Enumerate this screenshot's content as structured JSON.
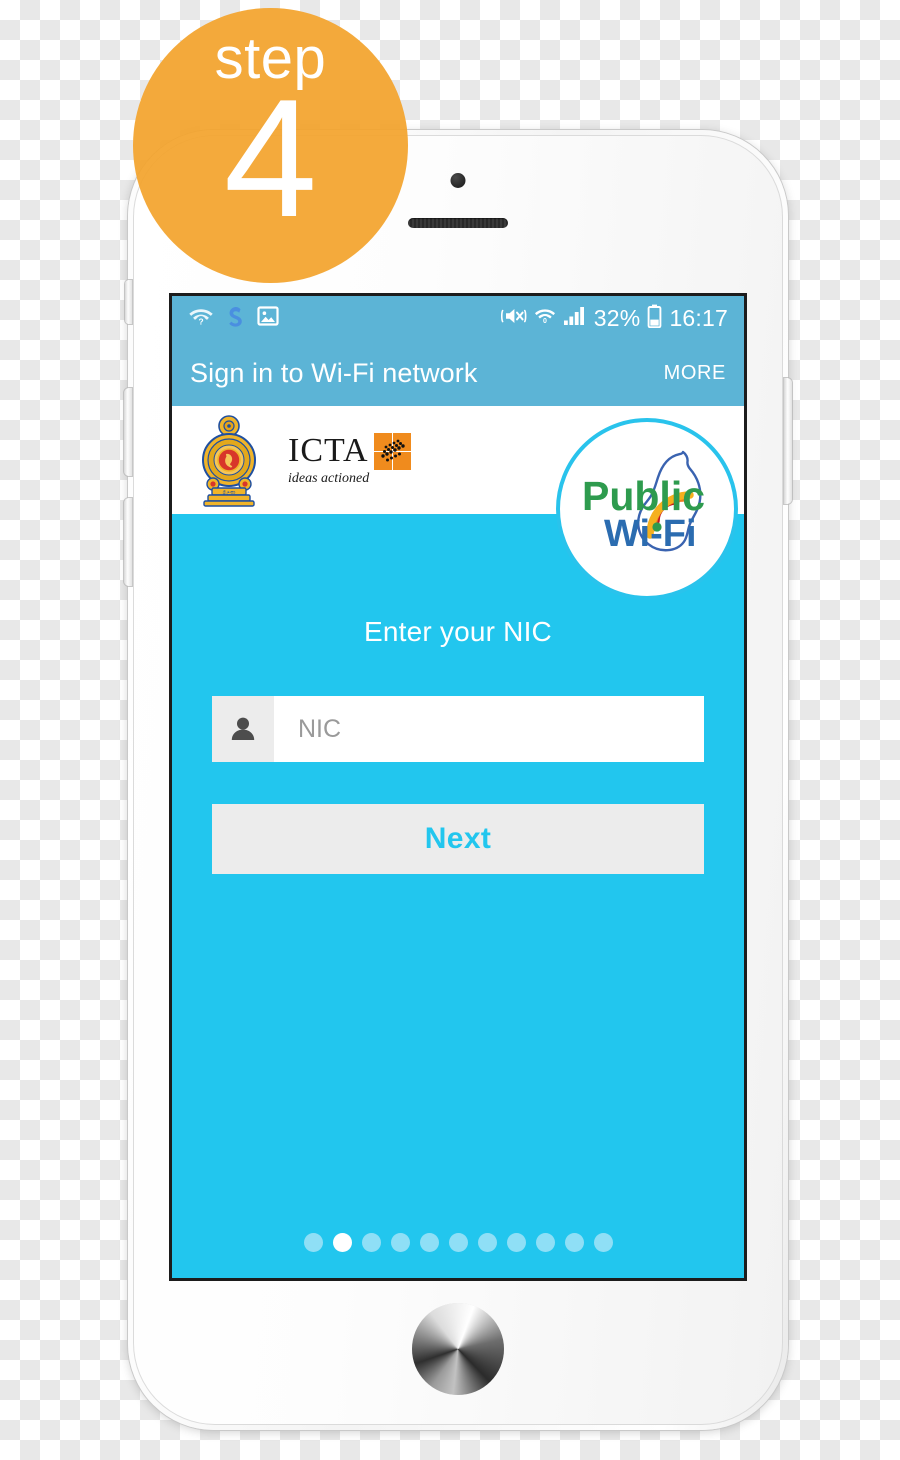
{
  "step_badge": {
    "label": "step",
    "number": "4",
    "color": "#f3a42d"
  },
  "device": {
    "name": "white-smartphone",
    "hardware": {
      "front_camera": "camera-icon",
      "earpiece_speaker": "speaker-grille",
      "home_button": "home-button",
      "silent_switch": "silent-switch",
      "volume_up": "volume-up-button",
      "volume_down": "volume-down-button",
      "power": "power-button"
    }
  },
  "screen": {
    "status_bar": {
      "background": "#5cb4d6",
      "left_icons": [
        "wifi-question-icon",
        "s-health-icon",
        "image-icon"
      ],
      "right_icons": [
        "mute-vibrate-icon",
        "wifi-icon",
        "signal-bars-icon",
        "battery-icon"
      ],
      "battery_percent": "32%",
      "clock": "16:17"
    },
    "action_bar": {
      "title": "Sign in to Wi-Fi network",
      "more_label": "MORE"
    },
    "logo_band": {
      "emblem_alt": "sri-lanka-government-emblem",
      "icta_name": "ICTA",
      "icta_tagline": "ideas actioned",
      "badge": {
        "word_top": "Public",
        "word_bottom": "Wi-Fi",
        "top_color": "#2e9b4e",
        "bottom_color": "#2b6cb0",
        "ring_color": "#29c3ec"
      }
    },
    "form": {
      "prompt": "Enter your NIC",
      "input": {
        "icon": "person-icon",
        "value": "",
        "placeholder": "NIC"
      },
      "submit_label": "Next",
      "accent_color": "#22c6ee"
    },
    "pager": {
      "total": 11,
      "active_index": 1
    }
  }
}
